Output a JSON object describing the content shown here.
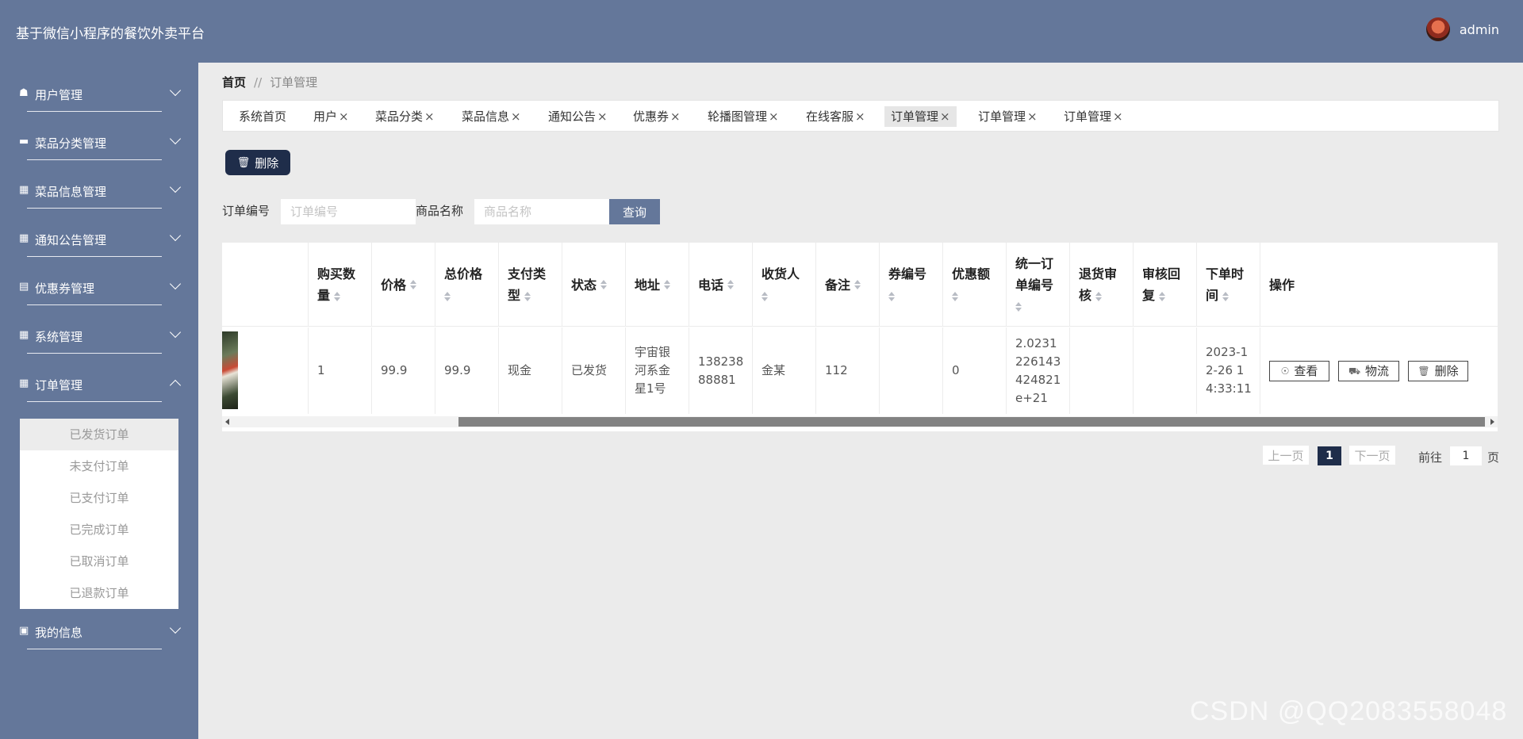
{
  "header": {
    "title": "基于微信小程序的餐饮外卖平台",
    "username": "admin"
  },
  "sidebar": {
    "items": [
      {
        "label": "用户管理",
        "icon": "user-icon"
      },
      {
        "label": "菜品分类管理",
        "icon": "monitor-icon"
      },
      {
        "label": "菜品信息管理",
        "icon": "grid-icon"
      },
      {
        "label": "通知公告管理",
        "icon": "grid-icon"
      },
      {
        "label": "优惠券管理",
        "icon": "print-icon"
      },
      {
        "label": "系统管理",
        "icon": "grid-icon"
      },
      {
        "label": "订单管理",
        "icon": "grid-icon"
      },
      {
        "label": "我的信息",
        "icon": "card-icon"
      }
    ],
    "submenu": [
      "已发货订单",
      "未支付订单",
      "已支付订单",
      "已完成订单",
      "已取消订单",
      "已退款订单"
    ]
  },
  "breadcrumb": {
    "home": "首页",
    "sep": "//",
    "current": "订单管理"
  },
  "tabs": [
    {
      "label": "系统首页"
    },
    {
      "label": "用户"
    },
    {
      "label": "菜品分类"
    },
    {
      "label": "菜品信息"
    },
    {
      "label": "通知公告"
    },
    {
      "label": "优惠券"
    },
    {
      "label": "轮播图管理"
    },
    {
      "label": "在线客服"
    },
    {
      "label": "订单管理"
    },
    {
      "label": "订单管理"
    },
    {
      "label": "订单管理"
    }
  ],
  "toolbar": {
    "delete_label": "删除"
  },
  "search": {
    "order_no_label": "订单编号",
    "order_no_placeholder": "订单编号",
    "product_label": "商品名称",
    "product_placeholder": "商品名称",
    "query_label": "查询"
  },
  "table": {
    "headers": [
      {
        "line1": "购买数",
        "line2": "量"
      },
      {
        "line1": "价格",
        "line2": ""
      },
      {
        "line1": "总价格",
        "line2": ""
      },
      {
        "line1": "支付类",
        "line2": "型"
      },
      {
        "line1": "状态",
        "line2": ""
      },
      {
        "line1": "地址",
        "line2": ""
      },
      {
        "line1": "电话",
        "line2": ""
      },
      {
        "line1": "收货人",
        "line2": ""
      },
      {
        "line1": "备注",
        "line2": ""
      },
      {
        "line1": "券编号",
        "line2": ""
      },
      {
        "line1": "优惠额",
        "line2": ""
      },
      {
        "line1": "统一订",
        "line2": "单编号"
      },
      {
        "line1": "退货审",
        "line2": "核"
      },
      {
        "line1": "审核回",
        "line2": "复"
      },
      {
        "line1": "下单时",
        "line2": "间"
      },
      {
        "line1": "操作",
        "line2": ""
      }
    ],
    "row": {
      "qty": "1",
      "price": "99.9",
      "total": "99.9",
      "pay_type": "现金",
      "status": "已发货",
      "address": [
        "宇宙银",
        "河系金",
        "星1号"
      ],
      "phone": [
        "138238",
        "88881"
      ],
      "receiver": "金某",
      "remark": "112",
      "coupon_no": "",
      "discount": "0",
      "order_no": [
        "2.0231",
        "226143",
        "424821",
        "e+21"
      ],
      "return_review": "",
      "review_reply": "",
      "time": [
        "2023-1",
        "2-26 1",
        "4:33:11"
      ]
    },
    "actions": {
      "view": "查看",
      "logistics": "物流",
      "delete": "删除"
    }
  },
  "pagination": {
    "prev": "上一页",
    "current": "1",
    "next": "下一页",
    "goto": "前往",
    "goto_value": "1",
    "page_unit": "页"
  },
  "watermark": "CSDN @QQ2083558048",
  "colors": {
    "sidebar": "#64779a",
    "primary_dark": "#1f2d4a",
    "background": "#ebebeb"
  }
}
